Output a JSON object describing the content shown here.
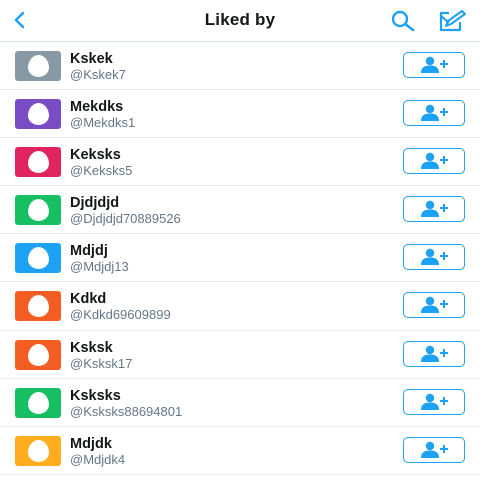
{
  "header": {
    "title": "Liked by",
    "back_icon": "chevron-left-icon",
    "search_icon": "search-icon",
    "compose_icon": "compose-icon",
    "accent_color": "#1da1f2"
  },
  "users": [
    {
      "name": "Kskek",
      "handle": "@Kskek7",
      "avatar_color": "#8899a6"
    },
    {
      "name": "Mekdks",
      "handle": "@Mekdks1",
      "avatar_color": "#794bc4"
    },
    {
      "name": "Keksks",
      "handle": "@Keksks5",
      "avatar_color": "#e0245e"
    },
    {
      "name": "Djdjdjd",
      "handle": "@Djdjdjd70889526",
      "avatar_color": "#17bf63"
    },
    {
      "name": "Mdjdj",
      "handle": "@Mdjdj13",
      "avatar_color": "#1da1f2"
    },
    {
      "name": "Kdkd",
      "handle": "@Kdkd69609899",
      "avatar_color": "#f45d22"
    },
    {
      "name": "Ksksk",
      "handle": "@Ksksk17",
      "avatar_color": "#f45d22"
    },
    {
      "name": "Ksksks",
      "handle": "@Ksksks88694801",
      "avatar_color": "#17bf63"
    },
    {
      "name": "Mdjdk",
      "handle": "@Mdjdk4",
      "avatar_color": "#ffad1f"
    }
  ],
  "follow_icon": "add-user-icon"
}
